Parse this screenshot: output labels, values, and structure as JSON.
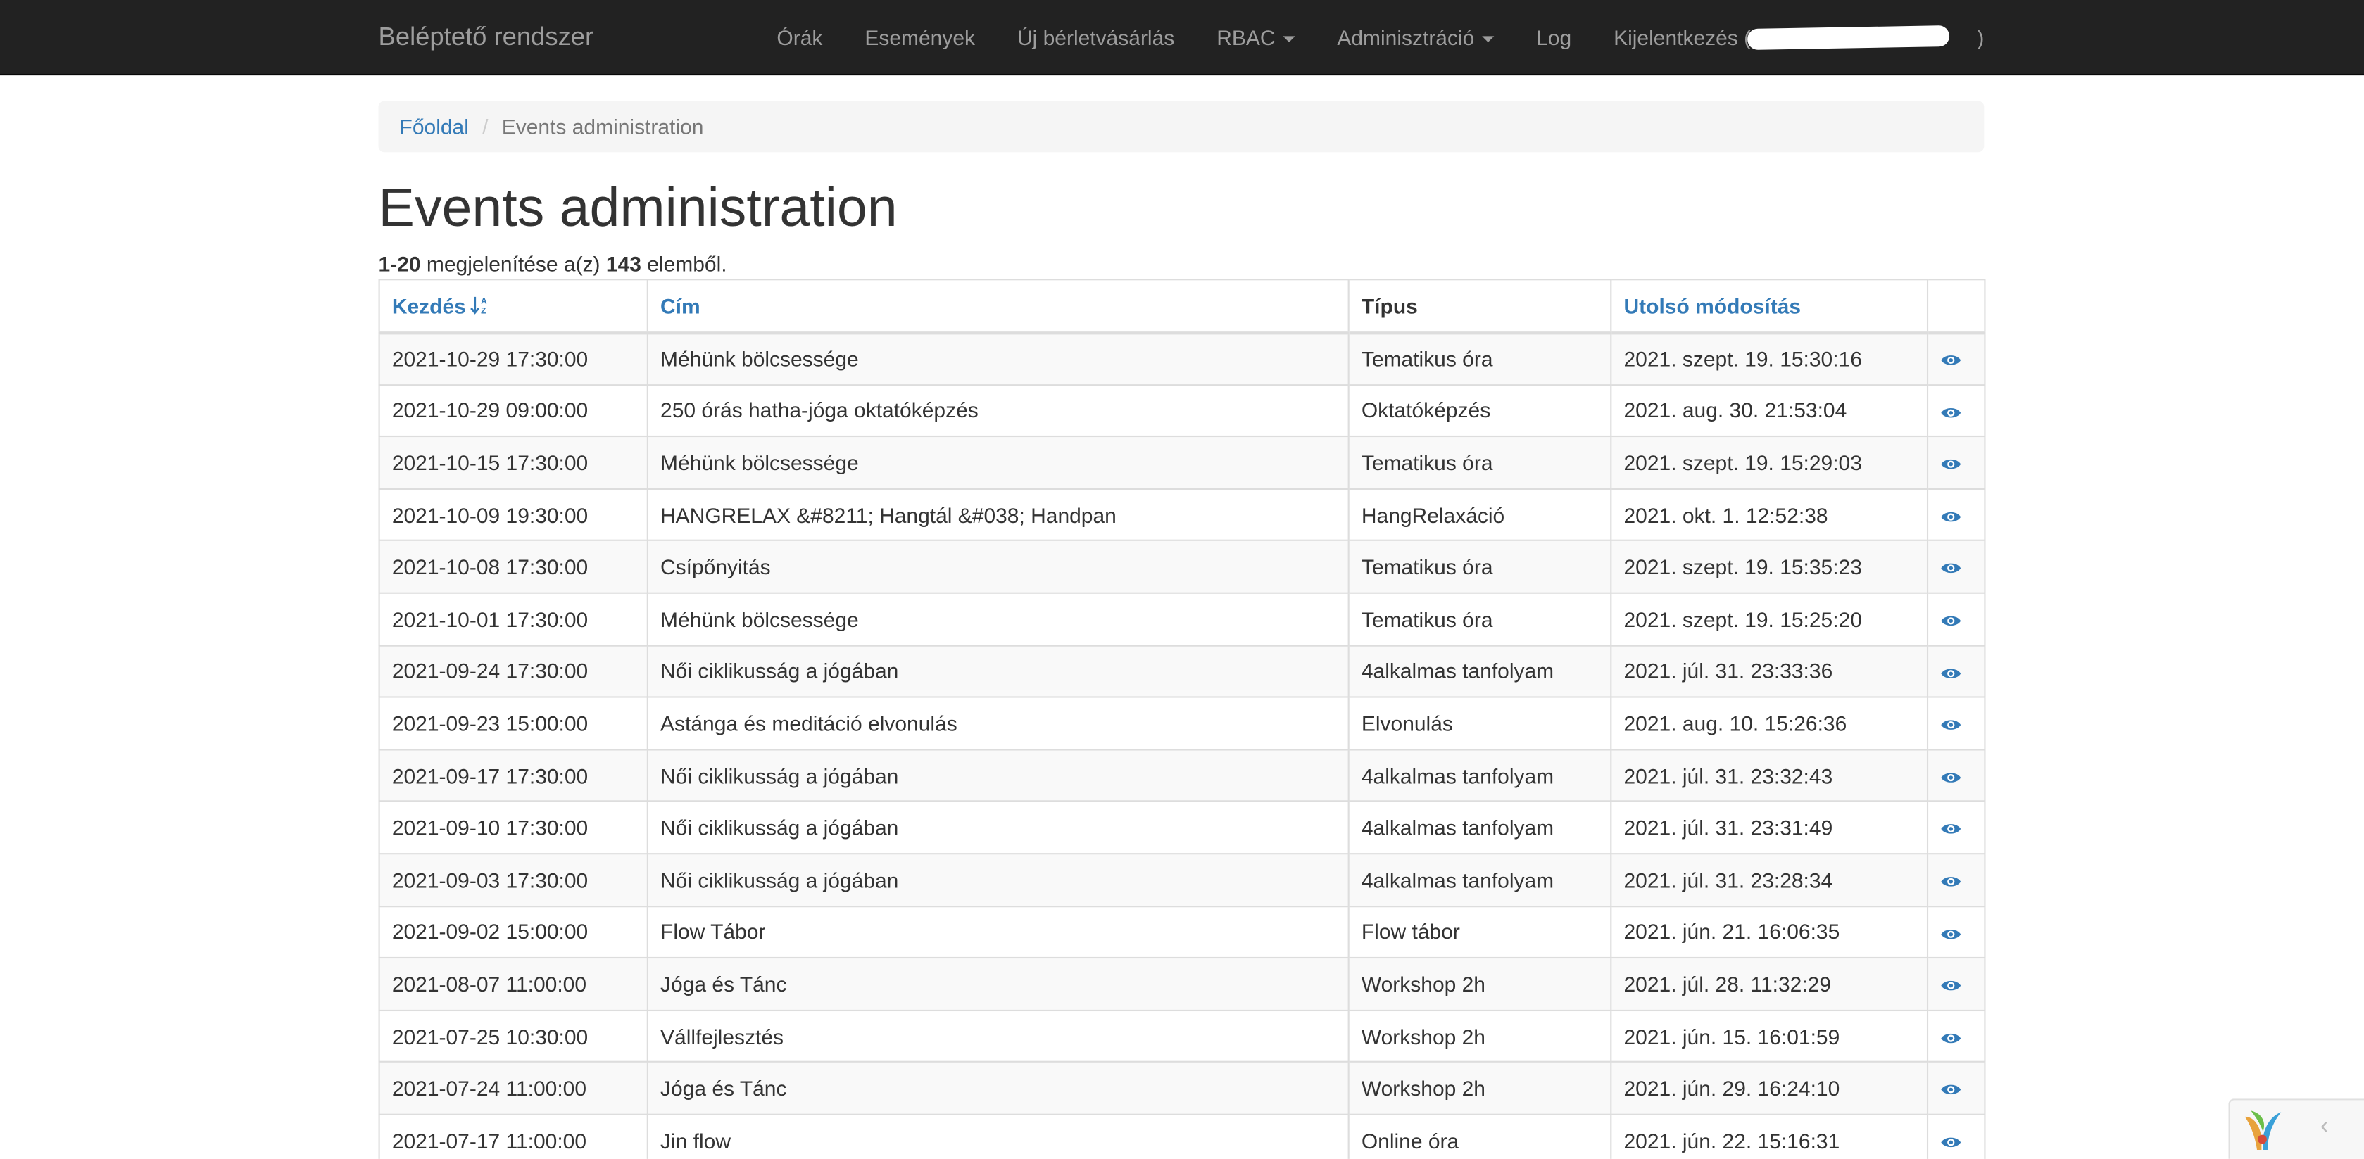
{
  "app": {
    "brand": "Beléptető rendszer"
  },
  "nav": {
    "items": [
      "Órák",
      "Események",
      "Új bérletvásárlás",
      "RBAC",
      "Adminisztráció",
      "Log"
    ],
    "logout": "Kijelentkezés (",
    "logout_end": ")"
  },
  "breadcrumb": {
    "home": "Főoldal",
    "current": "Events administration"
  },
  "page": {
    "title": "Events administration",
    "summary_range": "1-20",
    "summary_mid": " megjelenítése a(z) ",
    "summary_total": "143",
    "summary_end": " elemből."
  },
  "table": {
    "headers": [
      "Kezdés",
      "Cím",
      "Típus",
      "Utolsó módosítás"
    ],
    "rows": [
      [
        "2021-10-29 17:30:00",
        "Méhünk bölcsessége",
        "Tematikus óra",
        "2021. szept. 19. 15:30:16"
      ],
      [
        "2021-10-29 09:00:00",
        "250 órás hatha-jóga oktatóképzés",
        "Oktatóképzés",
        "2021. aug. 30. 21:53:04"
      ],
      [
        "2021-10-15 17:30:00",
        "Méhünk bölcsessége",
        "Tematikus óra",
        "2021. szept. 19. 15:29:03"
      ],
      [
        "2021-10-09 19:30:00",
        "HANGRELAX &#8211; Hangtál &#038; Handpan",
        "HangRelaxáció",
        "2021. okt. 1. 12:52:38"
      ],
      [
        "2021-10-08 17:30:00",
        "Csípőnyitás",
        "Tematikus óra",
        "2021. szept. 19. 15:35:23"
      ],
      [
        "2021-10-01 17:30:00",
        "Méhünk bölcsessége",
        "Tematikus óra",
        "2021. szept. 19. 15:25:20"
      ],
      [
        "2021-09-24 17:30:00",
        "Női ciklikusság a jógában",
        "4alkalmas tanfolyam",
        "2021. júl. 31. 23:33:36"
      ],
      [
        "2021-09-23 15:00:00",
        "Astánga és meditáció elvonulás",
        "Elvonulás",
        "2021. aug. 10. 15:26:36"
      ],
      [
        "2021-09-17 17:30:00",
        "Női ciklikusság a jógában",
        "4alkalmas tanfolyam",
        "2021. júl. 31. 23:32:43"
      ],
      [
        "2021-09-10 17:30:00",
        "Női ciklikusság a jógában",
        "4alkalmas tanfolyam",
        "2021. júl. 31. 23:31:49"
      ],
      [
        "2021-09-03 17:30:00",
        "Női ciklikusság a jógában",
        "4alkalmas tanfolyam",
        "2021. júl. 31. 23:28:34"
      ],
      [
        "2021-09-02 15:00:00",
        "Flow Tábor",
        "Flow tábor",
        "2021. jún. 21. 16:06:35"
      ],
      [
        "2021-08-07 11:00:00",
        "Jóga és Tánc",
        "Workshop 2h",
        "2021. júl. 28. 11:32:29"
      ],
      [
        "2021-07-25 10:30:00",
        "Vállfejlesztés",
        "Workshop 2h",
        "2021. jún. 15. 16:01:59"
      ],
      [
        "2021-07-24 11:00:00",
        "Jóga és Tánc",
        "Workshop 2h",
        "2021. jún. 29. 16:24:10"
      ],
      [
        "2021-07-17 11:00:00",
        "Jin flow",
        "Online óra",
        "2021. jún. 22. 15:16:31"
      ]
    ]
  },
  "icons": {
    "view": "eye-icon",
    "sort": "sort-alpha-asc-icon",
    "debug": "yii-logo-icon"
  },
  "colors": {
    "navbar": "#222222",
    "link": "#337ab7",
    "stripe": "#f9f9f9"
  }
}
